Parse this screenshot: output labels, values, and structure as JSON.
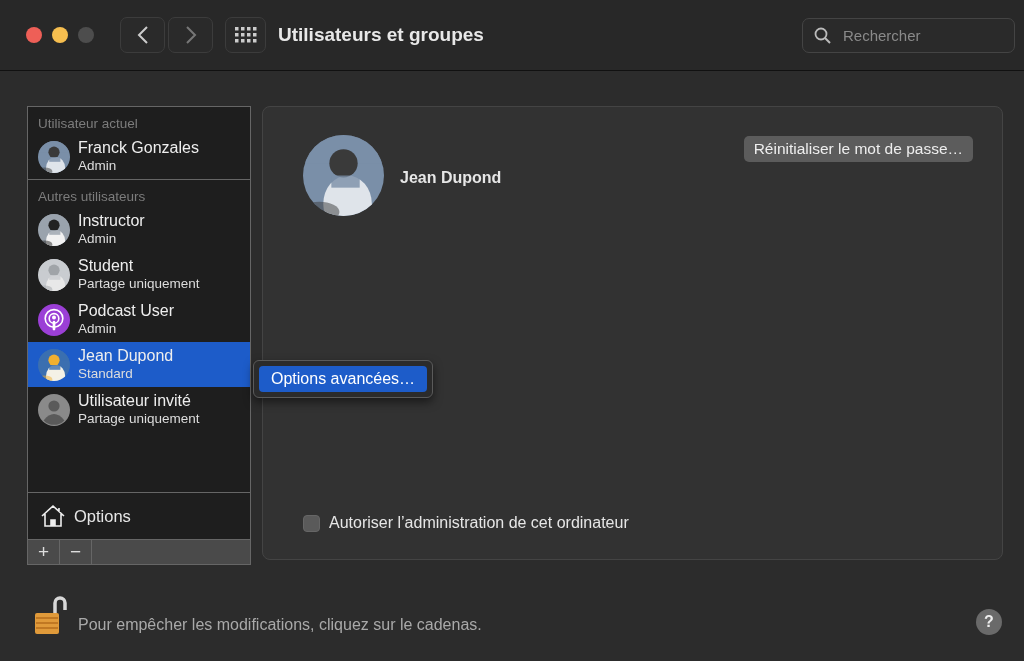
{
  "window": {
    "title": "Utilisateurs et groupes"
  },
  "search": {
    "placeholder": "Rechercher"
  },
  "sidebar": {
    "sections": [
      {
        "header": "Utilisateur actuel",
        "users": [
          {
            "name": "Franck Gonzales",
            "role": "Admin",
            "kind": "picture",
            "selected": false
          }
        ]
      },
      {
        "header": "Autres utilisateurs",
        "users": [
          {
            "name": "Instructor",
            "role": "Admin",
            "kind": "picture",
            "selected": false
          },
          {
            "name": "Student",
            "role": "Partage uniquement",
            "kind": "picture",
            "selected": false
          },
          {
            "name": "Podcast User",
            "role": "Admin",
            "kind": "podcast",
            "selected": false
          },
          {
            "name": "Jean Dupond",
            "role": "Standard",
            "kind": "picture",
            "selected": true
          },
          {
            "name": "Utilisateur invité",
            "role": "Partage uniquement",
            "kind": "guest",
            "selected": false
          }
        ]
      }
    ],
    "options_label": "Options",
    "add_label": "+",
    "remove_label": "−"
  },
  "context_menu": {
    "items": [
      {
        "label": "Options avancées…",
        "selected": true
      }
    ]
  },
  "detail": {
    "name": "Jean Dupond",
    "reset_button": "Réinitialiser le mot de passe…",
    "admin_checkbox": {
      "label": "Autoriser l’administration de cet ordinateur",
      "checked": false
    }
  },
  "footer": {
    "lock_text": "Pour empêcher les modifications, cliquez sur le cadenas.",
    "help_label": "?"
  }
}
